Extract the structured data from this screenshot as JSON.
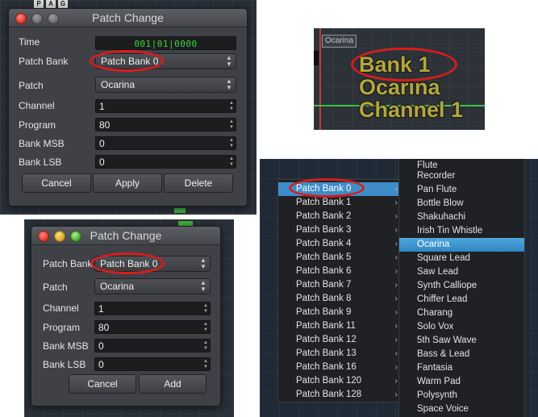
{
  "dialog_full": {
    "title": "Patch Change",
    "time_label": "Time",
    "time_value": "001|01|0000",
    "patch_bank_label": "Patch Bank",
    "patch_bank_value": "Patch Bank 0",
    "patch_label": "Patch",
    "patch_value": "Ocarina",
    "channel_label": "Channel",
    "channel_value": "1",
    "program_label": "Program",
    "program_value": "80",
    "bank_msb_label": "Bank MSB",
    "bank_msb_value": "0",
    "bank_lsb_label": "Bank LSB",
    "bank_lsb_value": "0",
    "cancel_label": "Cancel",
    "apply_label": "Apply",
    "delete_label": "Delete"
  },
  "daw_top_left": {
    "toolbar_buttons": [
      "P",
      "A",
      "G"
    ]
  },
  "zoom_panel": {
    "tag": "Ocarina",
    "line1": "Bank 1",
    "line2": "Ocarina",
    "line3": "Channel 1"
  },
  "dialog_add": {
    "title": "Patch Change",
    "patch_bank_label": "Patch Bank",
    "patch_bank_value": "Patch Bank 0",
    "patch_label": "Patch",
    "patch_value": "Ocarina",
    "channel_label": "Channel",
    "channel_value": "1",
    "program_label": "Program",
    "program_value": "80",
    "bank_msb_label": "Bank MSB",
    "bank_msb_value": "0",
    "bank_lsb_label": "Bank LSB",
    "bank_lsb_value": "0",
    "cancel_label": "Cancel",
    "add_label": "Add"
  },
  "bank_menu": {
    "items": [
      "Patch Bank 0",
      "Patch Bank 1",
      "Patch Bank 2",
      "Patch Bank 3",
      "Patch Bank 4",
      "Patch Bank 5",
      "Patch Bank 6",
      "Patch Bank 7",
      "Patch Bank 8",
      "Patch Bank 9",
      "Patch Bank 11",
      "Patch Bank 12",
      "Patch Bank 13",
      "Patch Bank 16",
      "Patch Bank 120",
      "Patch Bank 128"
    ],
    "selected": "Patch Bank 0"
  },
  "patch_menu": {
    "items": [
      "Flute",
      "Recorder",
      "Pan Flute",
      "Bottle Blow",
      "Shakuhachi",
      "Irish Tin Whistle",
      "Ocarina",
      "Square Lead",
      "Saw Lead",
      "Synth Calliope",
      "Chiffer Lead",
      "Charang",
      "Solo Vox",
      "5th Saw Wave",
      "Bass & Lead",
      "Fantasia",
      "Warm Pad",
      "Polysynth",
      "Space Voice"
    ],
    "selected": "Ocarina"
  },
  "colors": {
    "highlight": "#d81c1c",
    "selection": "#3e8dc8",
    "time_text": "#3ed13e",
    "zoom_text": "#b3a640"
  }
}
